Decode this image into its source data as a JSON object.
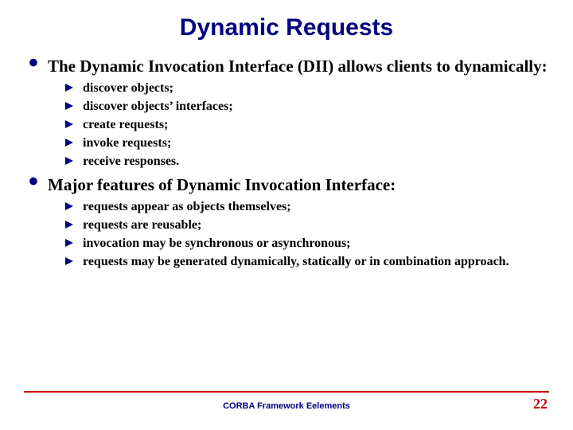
{
  "title": "Dynamic Requests",
  "bullets": [
    {
      "text": "The Dynamic Invocation Interface (DII) allows clients to dynamically:",
      "sub": [
        "discover objects;",
        "discover objects’ interfaces;",
        "create requests;",
        "invoke requests;",
        "receive responses."
      ]
    },
    {
      "text": "Major features of Dynamic Invocation Interface:",
      "sub": [
        "requests appear as objects themselves;",
        "requests are reusable;",
        "invocation may be synchronous or asynchronous;",
        "requests may be generated dynamically, statically or in combination approach."
      ]
    }
  ],
  "footer": {
    "center": "CORBA Framework Eelements",
    "page": "22"
  },
  "colors": {
    "accent": "#000080",
    "rule": "#cc0000"
  }
}
